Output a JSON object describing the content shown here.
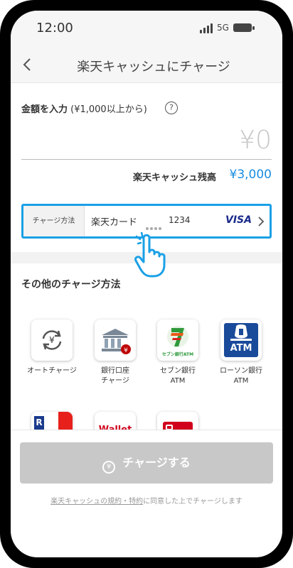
{
  "status": {
    "time": "12:00",
    "network": "5G"
  },
  "header": {
    "title": "楽天キャッシュにチャージ",
    "back_icon": "chevron-left-icon"
  },
  "amount": {
    "label_bold": "金額を入力",
    "label_note": " (¥1,000以上から)",
    "help_icon": "question-circle-icon",
    "value": "¥0",
    "balance_label": "楽天キャッシュ残高",
    "balance_value": "¥3,000"
  },
  "method": {
    "label": "チャージ方法",
    "card_name": "楽天カード",
    "card_last4": "1234",
    "brand": "VISA"
  },
  "other": {
    "title": "その他のチャージ方法",
    "options": [
      {
        "label": "オートチャージ",
        "icon": "auto-charge-icon"
      },
      {
        "label": "銀行口座\nチャージ",
        "icon": "bank-icon"
      },
      {
        "label": "セブン銀行\nATM",
        "icon": "seven-bank-icon"
      },
      {
        "label": "ローソン銀行\nATM",
        "icon": "lawson-bank-icon"
      }
    ],
    "seven_logo_text": "セブン銀行ATM",
    "lawson_logo_text": "ATM",
    "wallet_text": "Wallet"
  },
  "bottom": {
    "charge_button": "チャージする",
    "terms_link": "楽天キャッシュの規約・特約",
    "terms_rest": "に同意した上でチャージします"
  },
  "colors": {
    "accent": "#1aa0e6",
    "link": "#1a8de0",
    "visa": "#1a2a8c",
    "disabled": "#c8c8c8"
  }
}
